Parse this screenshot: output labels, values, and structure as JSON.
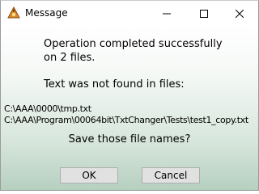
{
  "window": {
    "title": "Message",
    "icon": "warning-app-icon",
    "controls": [
      "minimize-icon",
      "maximize-icon",
      "close-icon"
    ]
  },
  "message": {
    "line1": "Operation completed successfully",
    "line2": "on 2 files.",
    "line3": "Text was not found in files:"
  },
  "files": [
    "C:\\AAA\\0000\\tmp.txt",
    "C:\\AAA\\Program\\00064bit\\TxtChanger\\Tests\\test1_copy.txt"
  ],
  "question": "Save those file names?",
  "buttons": {
    "ok": "OK",
    "cancel": "Cancel"
  },
  "colors": {
    "gradient_top": "#ffffff",
    "gradient_bottom": "#b5cfbf",
    "button_face": "#e1e1e1"
  }
}
